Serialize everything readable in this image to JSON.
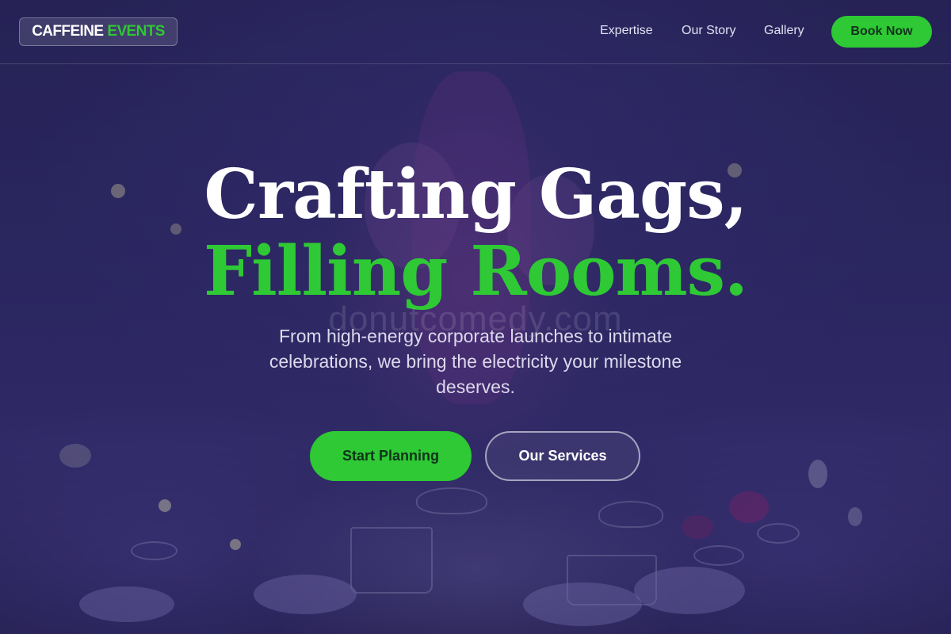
{
  "brand": {
    "name_part1": "CAFFEINE",
    "name_part2": "EVENTS"
  },
  "nav": {
    "items": [
      {
        "label": "Expertise"
      },
      {
        "label": "Our Story"
      },
      {
        "label": "Gallery"
      }
    ],
    "cta_label": "Book Now"
  },
  "hero": {
    "title_line1": "Crafting Gags,",
    "title_line2": "Filling Rooms.",
    "watermark": "donutcomedy.com",
    "subtitle": "From high-energy corporate launches to intimate celebrations, we bring the electricity your milestone deserves.",
    "primary_button": "Start Planning",
    "secondary_button": "Our Services"
  },
  "colors": {
    "accent": "#2ec934",
    "background": "#2e2a63",
    "text_light": "#ffffff"
  }
}
